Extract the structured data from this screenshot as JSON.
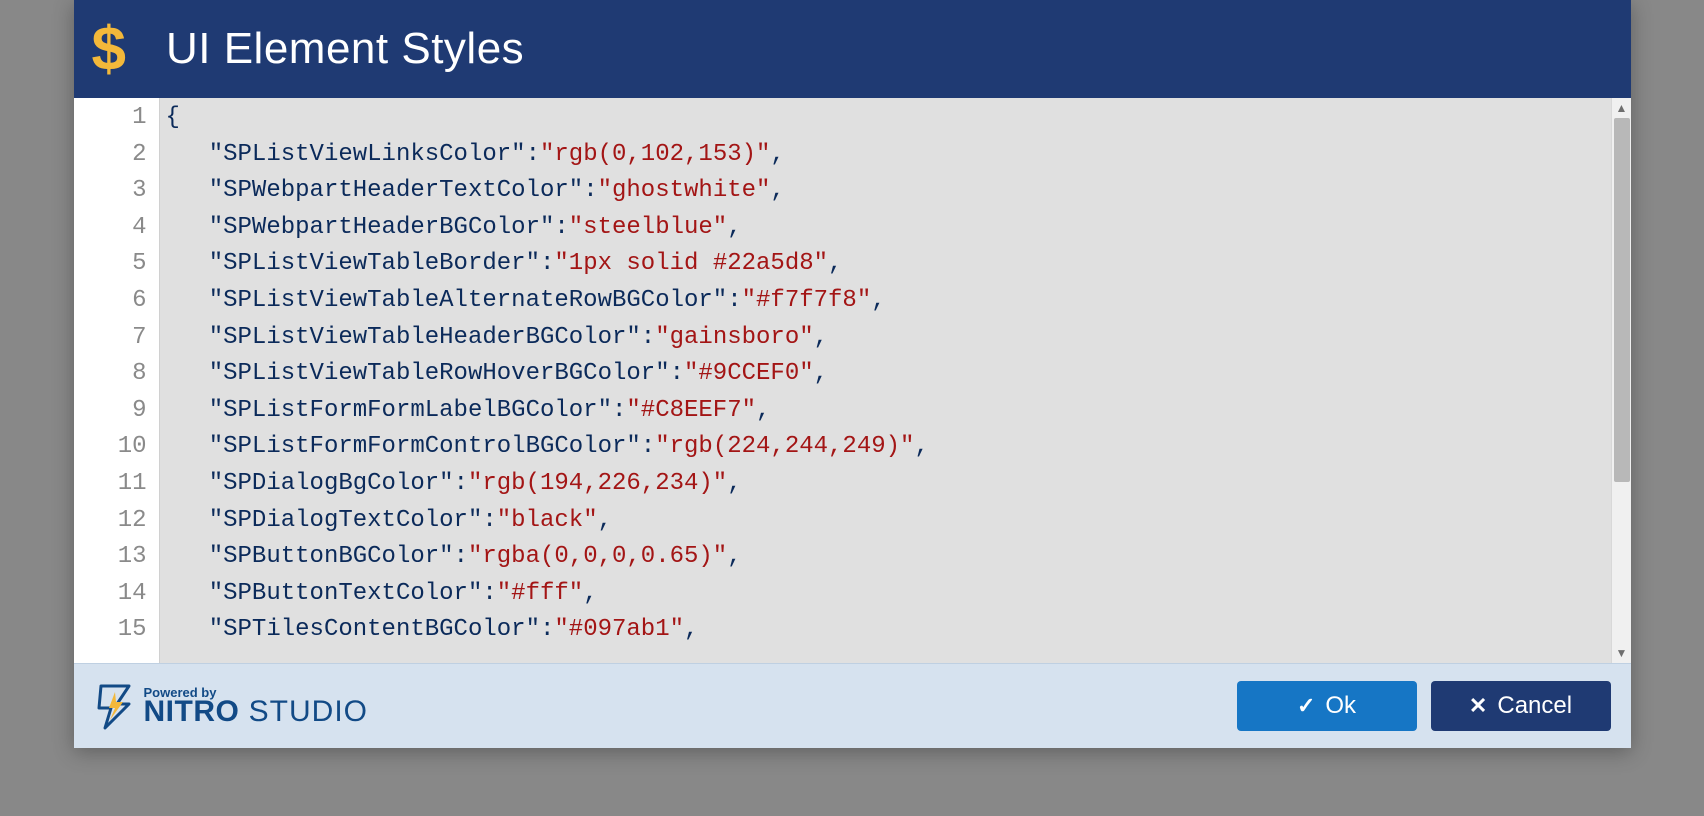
{
  "header": {
    "icon": "$",
    "title": "UI Element Styles"
  },
  "editor": {
    "lines": [
      {
        "n": 1,
        "tokens": [
          {
            "t": "punct",
            "v": "{"
          }
        ]
      },
      {
        "n": 2,
        "indent": 3,
        "key": "SPListViewLinksColor",
        "val": "rgb(0,102,153)",
        "comma": true
      },
      {
        "n": 3,
        "indent": 3,
        "key": "SPWebpartHeaderTextColor",
        "val": "ghostwhite",
        "comma": true
      },
      {
        "n": 4,
        "indent": 3,
        "key": "SPWebpartHeaderBGColor",
        "val": "steelblue",
        "comma": true
      },
      {
        "n": 5,
        "indent": 3,
        "key": "SPListViewTableBorder",
        "val": "1px solid #22a5d8",
        "comma": true
      },
      {
        "n": 6,
        "indent": 3,
        "key": "SPListViewTableAlternateRowBGColor",
        "val": "#f7f7f8",
        "comma": true
      },
      {
        "n": 7,
        "indent": 3,
        "key": "SPListViewTableHeaderBGColor",
        "val": "gainsboro",
        "comma": true
      },
      {
        "n": 8,
        "indent": 3,
        "key": "SPListViewTableRowHoverBGColor",
        "val": "#9CCEF0",
        "comma": true
      },
      {
        "n": 9,
        "indent": 3,
        "key": "SPListFormFormLabelBGColor",
        "val": "#C8EEF7",
        "comma": true
      },
      {
        "n": 10,
        "indent": 3,
        "key": "SPListFormFormControlBGColor",
        "val": "rgb(224,244,249)",
        "comma": true
      },
      {
        "n": 11,
        "indent": 3,
        "key": "SPDialogBgColor",
        "val": "rgb(194,226,234)",
        "comma": true
      },
      {
        "n": 12,
        "indent": 3,
        "key": "SPDialogTextColor",
        "val": "black",
        "comma": true
      },
      {
        "n": 13,
        "indent": 3,
        "key": "SPButtonBGColor",
        "val": "rgba(0,0,0,0.65)",
        "comma": true
      },
      {
        "n": 14,
        "indent": 3,
        "key": "SPButtonTextColor",
        "val": "#fff",
        "comma": true
      },
      {
        "n": 15,
        "indent": 3,
        "key": "SPTilesContentBGColor",
        "val": "#097ab1",
        "comma": true
      }
    ]
  },
  "footer": {
    "powered": "Powered by",
    "brand1": "NITRO",
    "brand2": " STUDIO",
    "ok": "Ok",
    "cancel": "Cancel"
  }
}
